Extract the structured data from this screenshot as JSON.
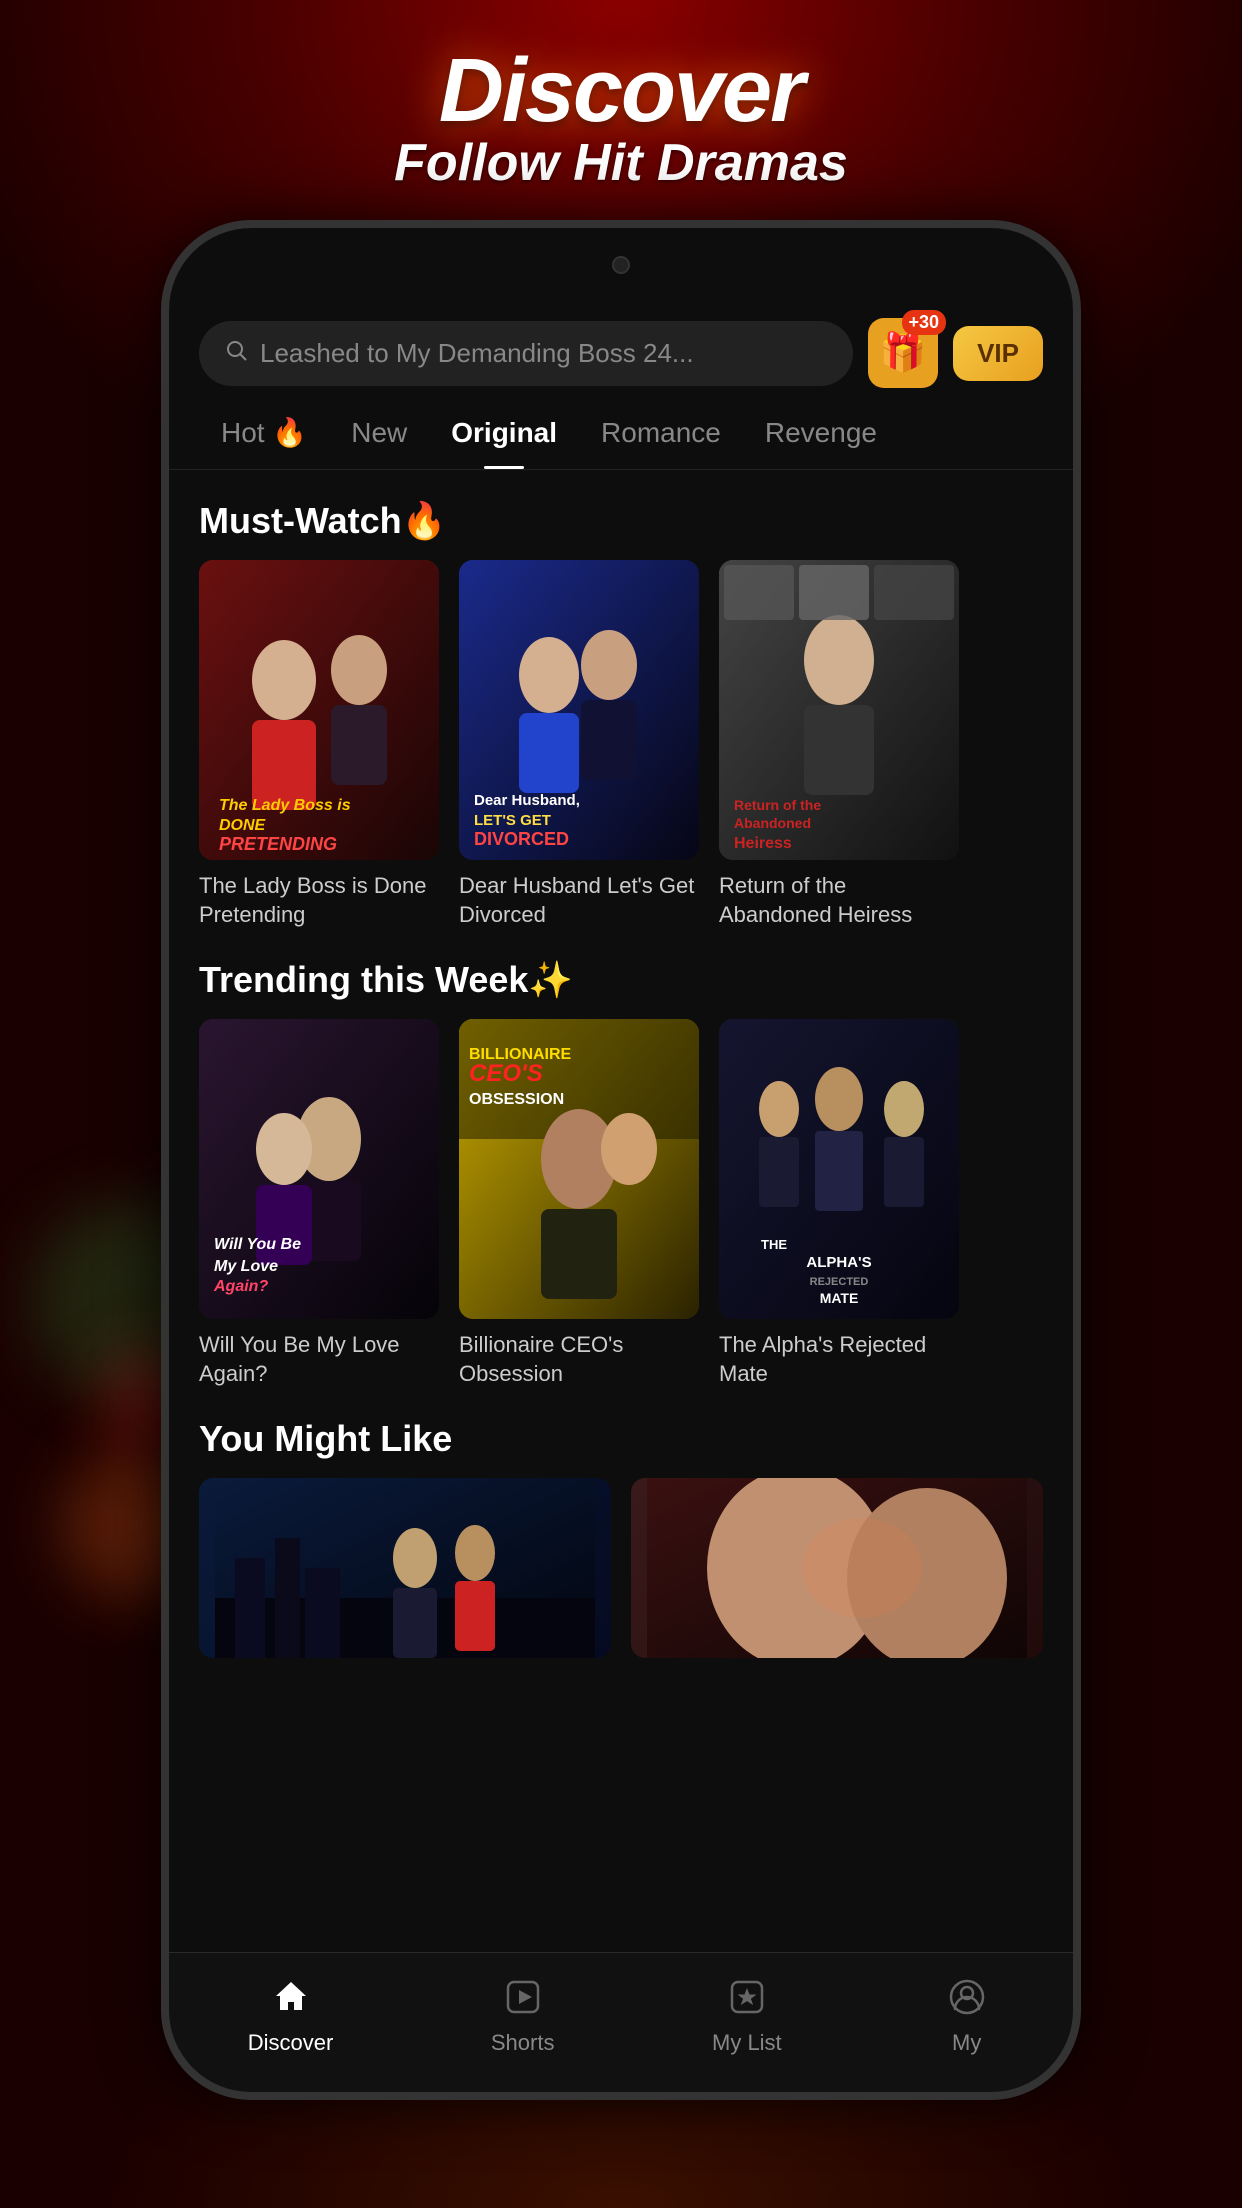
{
  "page": {
    "background_color": "#1a0000",
    "header": {
      "title": "Discover",
      "subtitle": "Follow Hit Dramas"
    },
    "search": {
      "placeholder": "Leashed to My Demanding Boss 24...",
      "gift_badge": "+30",
      "vip_label": "VIP"
    },
    "tabs": [
      {
        "label": "Hot",
        "icon": "🔥",
        "active": false
      },
      {
        "label": "New",
        "active": false
      },
      {
        "label": "Original",
        "active": true
      },
      {
        "label": "Romance",
        "active": false
      },
      {
        "label": "Revenge",
        "active": false
      }
    ],
    "sections": [
      {
        "id": "must-watch",
        "title": "Must-Watch🔥",
        "items": [
          {
            "title": "The Lady Boss is Done Pretending",
            "poster_style": "lady-boss"
          },
          {
            "title": "Dear Husband Let's Get Divorced",
            "poster_style": "dear-husband"
          },
          {
            "title": "Return of the Abandoned Heiress",
            "poster_style": "heiress"
          }
        ]
      },
      {
        "id": "trending",
        "title": "Trending this Week✨",
        "items": [
          {
            "title": "Will You Be My Love Again?",
            "poster_style": "love-again"
          },
          {
            "title": "Billionaire CEO's Obsession",
            "poster_style": "ceo"
          },
          {
            "title": "The Alpha's Rejected Mate",
            "poster_style": "alpha"
          }
        ]
      },
      {
        "id": "you-might-like",
        "title": "You Might Like",
        "items": [
          {
            "title": "",
            "poster_style": "you-might1"
          },
          {
            "title": "",
            "poster_style": "you-might2"
          }
        ]
      }
    ],
    "bottom_nav": [
      {
        "id": "discover",
        "label": "Discover",
        "icon": "house",
        "active": true
      },
      {
        "id": "shorts",
        "label": "Shorts",
        "icon": "play-square",
        "active": false
      },
      {
        "id": "my-list",
        "label": "My List",
        "icon": "star-square",
        "active": false
      },
      {
        "id": "my",
        "label": "My",
        "icon": "person-circle",
        "active": false
      }
    ]
  }
}
